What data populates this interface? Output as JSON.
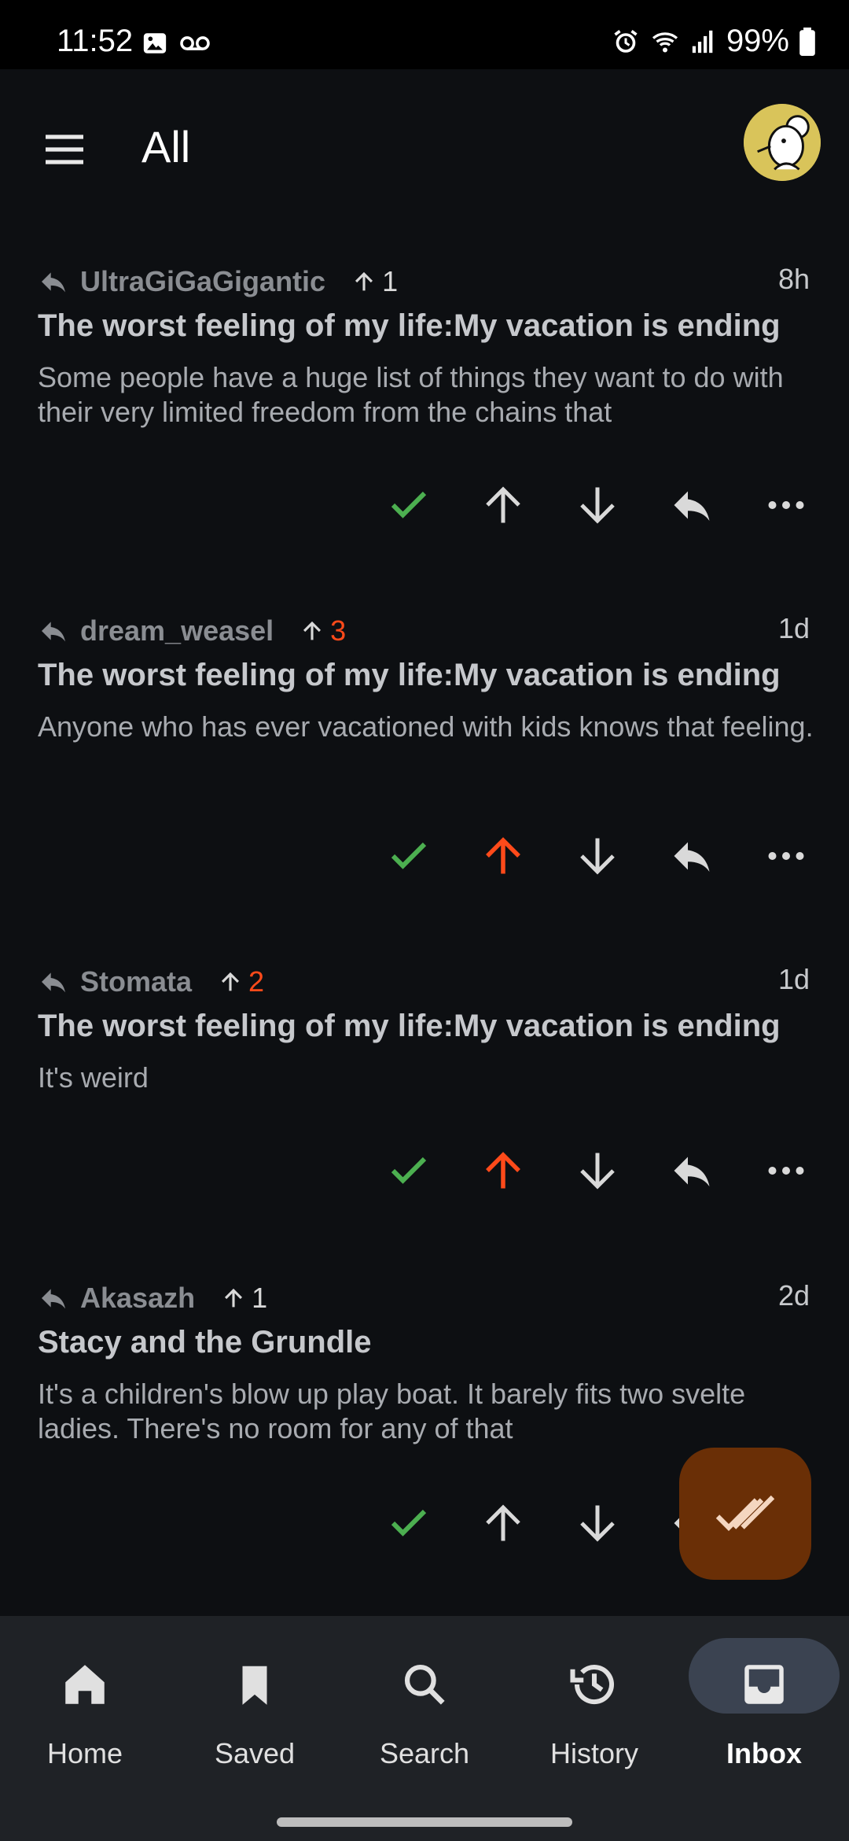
{
  "status_bar": {
    "time": "11:52",
    "battery": "99%"
  },
  "app_bar": {
    "title": "All"
  },
  "posts": [
    {
      "author": "UltraGiGaGigantic",
      "score": "1",
      "score_hot": false,
      "time": "8h",
      "title": "The worst feeling of my life:My vacation is ending",
      "body": "Some people have a huge list of things they want to do with their very limited freedom from the chains that",
      "upvoted": false
    },
    {
      "author": "dream_weasel",
      "score": "3",
      "score_hot": true,
      "time": "1d",
      "title": "The worst feeling of my life:My vacation is ending",
      "body": "Anyone who has ever vacationed with kids knows that feeling.",
      "upvoted": true
    },
    {
      "author": "Stomata",
      "score": "2",
      "score_hot": true,
      "time": "1d",
      "title": "The worst feeling of my life:My vacation is ending",
      "body": "It's weird",
      "upvoted": true
    },
    {
      "author": "Akasazh",
      "score": "1",
      "score_hot": false,
      "time": "2d",
      "title": "Stacy and the Grundle",
      "body": "It's a children's blow up play boat. It barely fits two svelte ladies. There's no room for any of that",
      "upvoted": false
    }
  ],
  "colors": {
    "accent_upvote": "#ff4a1a",
    "check_green": "#4caf50",
    "fab_bg": "#6a2f06"
  },
  "bottom_nav": {
    "items": [
      {
        "label": "Home",
        "icon": "home-icon"
      },
      {
        "label": "Saved",
        "icon": "bookmark-icon"
      },
      {
        "label": "Search",
        "icon": "search-icon"
      },
      {
        "label": "History",
        "icon": "history-icon"
      },
      {
        "label": "Inbox",
        "icon": "inbox-icon",
        "active": true
      }
    ]
  }
}
